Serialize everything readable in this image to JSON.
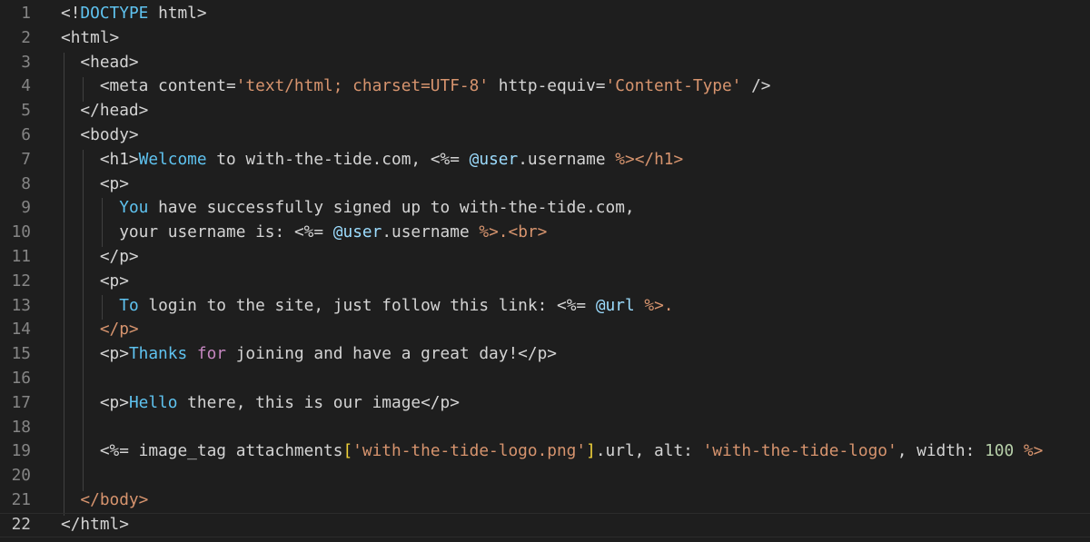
{
  "editor": {
    "current_line": "22",
    "lines": [
      {
        "num": "1",
        "tokens": [
          [
            "t-tag",
            "<!"
          ],
          [
            "t-kw",
            "DOCTYPE"
          ],
          [
            "t-tag",
            " html>"
          ]
        ]
      },
      {
        "num": "2",
        "tokens": [
          [
            "t-tag",
            "<html>"
          ]
        ]
      },
      {
        "num": "3",
        "tokens": [
          [
            "t-tag",
            "  <head>"
          ]
        ]
      },
      {
        "num": "4",
        "tokens": [
          [
            "t-tag",
            "    <meta content="
          ],
          [
            "t-str",
            "'text/html; charset=UTF-8'"
          ],
          [
            "t-tag",
            " http-equiv="
          ],
          [
            "t-str",
            "'Content-Type'"
          ],
          [
            "t-tag",
            " />"
          ]
        ]
      },
      {
        "num": "5",
        "tokens": [
          [
            "t-tag",
            "  </head>"
          ]
        ]
      },
      {
        "num": "6",
        "tokens": [
          [
            "t-tag",
            "  <body>"
          ]
        ]
      },
      {
        "num": "7",
        "tokens": [
          [
            "t-tag",
            "    <h1>"
          ],
          [
            "t-kw",
            "Welcome"
          ],
          [
            "t-text",
            " to with-the-tide.com, "
          ],
          [
            "t-text",
            "<%="
          ],
          [
            "t-text",
            " "
          ],
          [
            "t-ivar",
            "@user"
          ],
          [
            "t-text",
            ".username "
          ],
          [
            "t-erb",
            "%>"
          ],
          [
            "t-erb",
            "</h1>"
          ]
        ]
      },
      {
        "num": "8",
        "tokens": [
          [
            "t-tag",
            "    <p>"
          ]
        ]
      },
      {
        "num": "9",
        "tokens": [
          [
            "t-text",
            "      "
          ],
          [
            "t-kw",
            "You"
          ],
          [
            "t-text",
            " have successfully signed up to with-the-tide.com,"
          ]
        ]
      },
      {
        "num": "10",
        "tokens": [
          [
            "t-text",
            "      your username is: "
          ],
          [
            "t-text",
            "<%="
          ],
          [
            "t-text",
            " "
          ],
          [
            "t-ivar",
            "@user"
          ],
          [
            "t-text",
            ".username "
          ],
          [
            "t-erb",
            "%>"
          ],
          [
            "t-erb",
            ".<br>"
          ]
        ]
      },
      {
        "num": "11",
        "tokens": [
          [
            "t-tag",
            "    </p>"
          ]
        ]
      },
      {
        "num": "12",
        "tokens": [
          [
            "t-tag",
            "    <p>"
          ]
        ]
      },
      {
        "num": "13",
        "tokens": [
          [
            "t-text",
            "      "
          ],
          [
            "t-kw",
            "To"
          ],
          [
            "t-text",
            " login to the site, just follow this link: "
          ],
          [
            "t-text",
            "<%="
          ],
          [
            "t-text",
            " "
          ],
          [
            "t-ivar",
            "@url"
          ],
          [
            "t-text",
            " "
          ],
          [
            "t-erb",
            "%>"
          ],
          [
            "t-erb",
            "."
          ]
        ]
      },
      {
        "num": "14",
        "tokens": [
          [
            "t-erb",
            "    </p>"
          ]
        ]
      },
      {
        "num": "15",
        "tokens": [
          [
            "t-tag",
            "    <p>"
          ],
          [
            "t-kw",
            "Thanks"
          ],
          [
            "t-text",
            " "
          ],
          [
            "t-pink",
            "for"
          ],
          [
            "t-text",
            " joining and have a great day!</p>"
          ]
        ]
      },
      {
        "num": "16",
        "tokens": []
      },
      {
        "num": "17",
        "tokens": [
          [
            "t-tag",
            "    <p>"
          ],
          [
            "t-kw",
            "Hello"
          ],
          [
            "t-text",
            " there, this is our image</p>"
          ]
        ]
      },
      {
        "num": "18",
        "tokens": []
      },
      {
        "num": "19",
        "tokens": [
          [
            "t-text",
            "    <%= image_tag attachments"
          ],
          [
            "t-gold",
            "["
          ],
          [
            "t-str",
            "'with-the-tide-logo.png'"
          ],
          [
            "t-gold",
            "]"
          ],
          [
            "t-text",
            ".url, alt: "
          ],
          [
            "t-str",
            "'with-the-tide-logo'"
          ],
          [
            "t-text",
            ", width: "
          ],
          [
            "t-num",
            "100"
          ],
          [
            "t-text",
            " "
          ],
          [
            "t-erb",
            "%>"
          ]
        ]
      },
      {
        "num": "20",
        "tokens": []
      },
      {
        "num": "21",
        "tokens": [
          [
            "t-erb",
            "  </body>"
          ]
        ]
      },
      {
        "num": "22",
        "tokens": [
          [
            "t-tag",
            "</html>"
          ]
        ]
      }
    ]
  }
}
